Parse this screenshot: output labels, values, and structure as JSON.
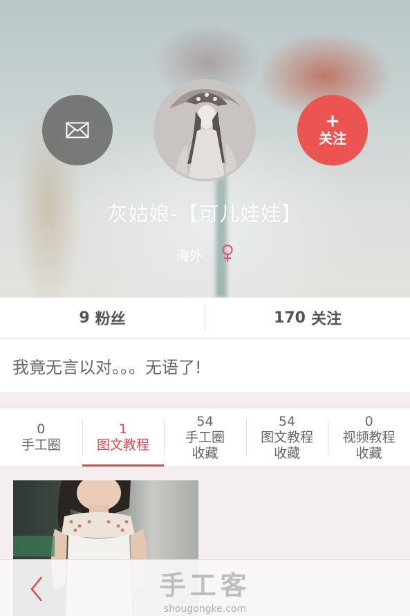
{
  "profile": {
    "username": "灰姑娘-【可儿娃娃】",
    "location": "海外",
    "gender_icon": "female-symbol-icon",
    "gender_color": "#e8557a",
    "follow_plus": "+",
    "follow_label": "关注",
    "mail_icon": "envelope-icon"
  },
  "stats": {
    "fans_count": "9",
    "fans_label": "粉丝",
    "following_count": "170",
    "following_label": "关注"
  },
  "bio": "我竟无言以对。。。无语了!",
  "tabs": [
    {
      "count": "0",
      "line1": "手工圈",
      "line2": ""
    },
    {
      "count": "1",
      "line1": "图文教程",
      "line2": ""
    },
    {
      "count": "54",
      "line1": "手工圈",
      "line2": "收藏"
    },
    {
      "count": "54",
      "line1": "图文教程",
      "line2": "收藏"
    },
    {
      "count": "0",
      "line1": "视频教程",
      "line2": "收藏"
    }
  ],
  "active_tab": "图文教程",
  "bottom": {
    "back_icon": "chevron-left-icon",
    "watermark_title": "手工客",
    "watermark_url": "shougongke.com"
  },
  "colors": {
    "accent": "#e04b4b",
    "follow_button": "#ec5451"
  }
}
